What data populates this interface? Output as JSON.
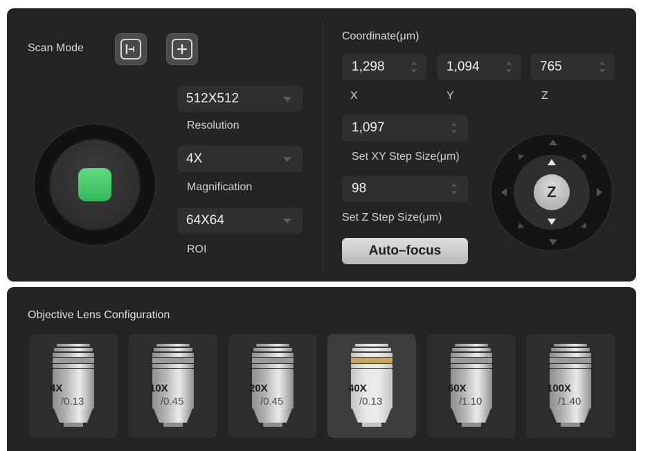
{
  "scan_mode": {
    "label": "Scan Mode",
    "buttons": [
      {
        "icon": "scan-mode-left-icon"
      },
      {
        "icon": "scan-mode-center-icon"
      }
    ]
  },
  "start_button": {
    "color": "#3fc866"
  },
  "settings": {
    "resolution": {
      "value": "512X512",
      "label": "Resolution"
    },
    "magnification": {
      "value": "4X",
      "label": "Magnification"
    },
    "roi": {
      "value": "64X64",
      "label": "ROI"
    }
  },
  "coordinate": {
    "title": "Coordinate(μm)",
    "x": {
      "value": "1,298",
      "label": "X"
    },
    "y": {
      "value": "1,094",
      "label": "Y"
    },
    "z": {
      "value": "765",
      "label": "Z"
    }
  },
  "xy_step": {
    "value": "1,097",
    "label": "Set XY Step Size(μm)"
  },
  "z_step": {
    "value": "98",
    "label": "Set Z  Step Size(μm)"
  },
  "autofocus": {
    "label": "Auto–focus"
  },
  "joystick": {
    "center_label": "Z"
  },
  "objective": {
    "title": "Objective Lens Configuration",
    "lenses": [
      {
        "mag": "4X",
        "na": "/0.13",
        "selected": false
      },
      {
        "mag": "10X",
        "na": "/0.45",
        "selected": false
      },
      {
        "mag": "20X",
        "na": "/0.45",
        "selected": false
      },
      {
        "mag": "40X",
        "na": "/0.13",
        "selected": true
      },
      {
        "mag": "60X",
        "na": "/1.10",
        "selected": false
      },
      {
        "mag": "100X",
        "na": "/1.40",
        "selected": false
      }
    ]
  },
  "colors": {
    "panel_bg": "#242424",
    "field_bg": "#2f2f2f",
    "accent_green": "#3fc866",
    "selected_lens_band": "#c9a65a"
  }
}
